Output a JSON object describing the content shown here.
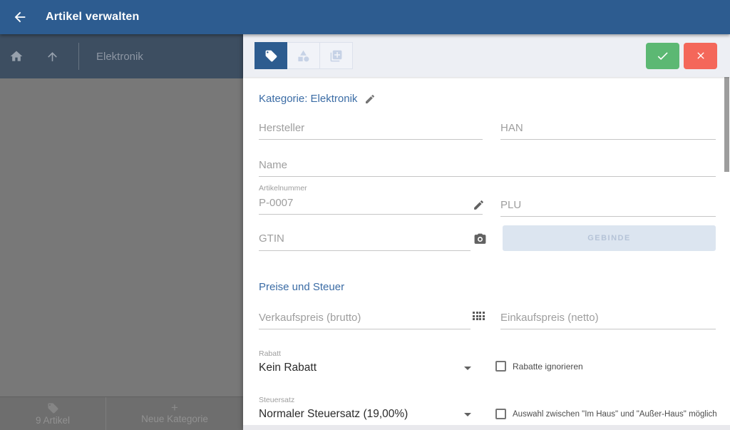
{
  "app_bar": {
    "title": "Artikel verwalten"
  },
  "left_panel": {
    "breadcrumb": "Elektronik",
    "footer": {
      "articles_label": "9 Artikel",
      "new_category_label": "Neue Kategorie",
      "plus_glyph": "+"
    }
  },
  "toolbar": {
    "tabs": [
      {
        "name": "article-details",
        "icon": "tag-icon",
        "active": true
      },
      {
        "name": "variants",
        "icon": "shapes-icon",
        "active": false
      },
      {
        "name": "duplicate",
        "icon": "copy-plus-icon",
        "active": false
      }
    ],
    "confirm": "check-icon",
    "cancel": "close-icon"
  },
  "form": {
    "category_heading": "Kategorie: Elektronik",
    "hersteller": {
      "placeholder": "Hersteller"
    },
    "han": {
      "placeholder": "HAN"
    },
    "name": {
      "placeholder": "Name"
    },
    "artikelnummer": {
      "label": "Artikelnummer",
      "value": "P-0007"
    },
    "plu": {
      "placeholder": "PLU"
    },
    "gtin": {
      "placeholder": "GTIN"
    },
    "gebinde_label": "GEBINDE",
    "section_heading": "Preise und Steuer",
    "verkaufspreis": {
      "placeholder": "Verkaufspreis (brutto)"
    },
    "einkaufspreis": {
      "placeholder": "Einkaufspreis (netto)"
    },
    "rabatt": {
      "label": "Rabatt",
      "value": "Kein Rabatt",
      "checkbox_label": "Rabatte ignorieren"
    },
    "steuersatz": {
      "label": "Steuersatz",
      "value": "Normaler Steuersatz (19,00%)",
      "checkbox_label": "Auswahl zwischen \"Im Haus\" und \"Außer-Haus\" möglich"
    }
  },
  "icons": {
    "back": "arrow-left",
    "home": "house",
    "up": "arrow-up",
    "tag": "label-tag",
    "shapes": "triangle-square-circle",
    "copy_plus": "duplicate-add",
    "check": "checkmark",
    "close": "x-mark",
    "pencil": "edit-pencil",
    "camera": "barcode-camera",
    "dialpad": "numeric-keypad",
    "caret": "dropdown-arrow"
  },
  "colors": {
    "app_bar": "#2d5c90",
    "left_header": "#3d4e61",
    "overlay": "#787878",
    "footer": "#6e6e6e",
    "toolbar_bg": "#edeff4",
    "active_tab": "#2d5c8f",
    "confirm_green": "#5cb873",
    "cancel_red": "#f4675a",
    "heading_blue": "#3b6ca5",
    "gebinde_bg": "#dce5f0"
  }
}
